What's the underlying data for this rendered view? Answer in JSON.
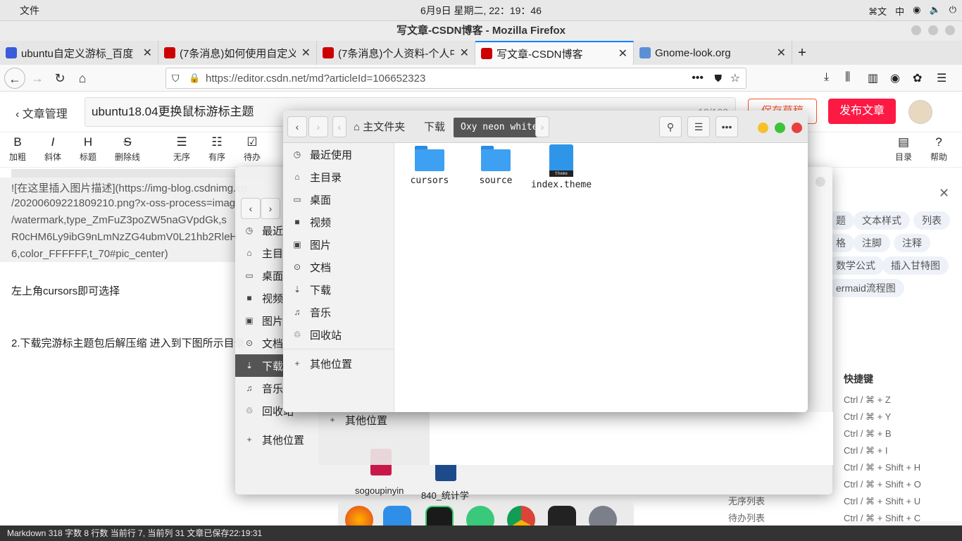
{
  "menubar": {
    "app_menu": "文件",
    "clock": "6月9日 星期二, 22：19：46",
    "tray": [
      "⌘文",
      "中",
      "◉",
      "🔈",
      "⏻"
    ]
  },
  "window": {
    "title": "写文章-CSDN博客 - Mozilla Firefox"
  },
  "tabs": [
    {
      "title": "ubuntu自定义游标_百度",
      "color": "#3b5bdb"
    },
    {
      "title": "(7条消息)如何使用自定义",
      "color": "#c00"
    },
    {
      "title": "(7条消息)个人资料-个人中",
      "color": "#c00"
    },
    {
      "title": "写文章-CSDN博客",
      "color": "#c00"
    },
    {
      "title": "Gnome-look.org",
      "color": "#5b8fd8"
    }
  ],
  "nav": {
    "url": "https://editor.csdn.net/md?articleId=106652323",
    "url_host": "csdn.net"
  },
  "editor": {
    "back_label": "文章管理",
    "title_value": "ubuntu18.04更换鼠标游标主题",
    "title_count": "19/100",
    "save_label": "保存草稿",
    "publish_label": "发布文章"
  },
  "toolbar": [
    {
      "glyph": "B",
      "label": "加粗"
    },
    {
      "glyph": "I",
      "label": "斜体"
    },
    {
      "glyph": "H",
      "label": "标题"
    },
    {
      "glyph": "S",
      "label": "删除线"
    },
    {
      "glyph": "☰",
      "label": "无序"
    },
    {
      "glyph": "☷",
      "label": "有序"
    },
    {
      "glyph": "☑",
      "label": "待办"
    }
  ],
  "toolbar_right": [
    {
      "glyph": "▤",
      "label": "目录"
    },
    {
      "glyph": "?",
      "label": "帮助"
    }
  ],
  "content": {
    "lines": [
      "![在这里插入图片描述](https://img-blog.csdnimg.cn",
      "/20200609221809210.png?x-oss-process=imag",
      "/watermark,type_ZmFuZ3poZW5naGVpdGk,s",
      "R0cHM6Ly9ibG9nLmNzZG4ubmV0L21hb2RleH",
      "6,color_FFFFFF,t_70#pic_center)",
      "左上角cursors即可选择",
      "2.下载完游标主题包后解压缩  进入到下图所示目录"
    ]
  },
  "right_panel": {
    "pills": [
      "题",
      "文本样式",
      "列表",
      "格",
      "注脚",
      "注释",
      "数学公式",
      "插入甘特图",
      "ermaid流程图"
    ],
    "shortcut_header": "快捷键",
    "shortcuts": [
      "Ctrl / ⌘ + Z",
      "Ctrl / ⌘ + Y",
      "Ctrl / ⌘ + B",
      "Ctrl / ⌘ + I",
      "Ctrl / ⌘ + Shift + H",
      "Ctrl / ⌘ + Shift + O",
      "Ctrl / ⌘ + Shift + U",
      "Ctrl / ⌘ + Shift + C"
    ],
    "list_labels": [
      "无序列表",
      "待办列表"
    ]
  },
  "statusbar": {
    "text": "Markdown  318 字数  8 行数  当前行 7, 当前列 31  文章已保存22:19:31"
  },
  "fm_sidebar": [
    {
      "icon": "◷",
      "label": "最近使用"
    },
    {
      "icon": "⌂",
      "label": "主目录"
    },
    {
      "icon": "▭",
      "label": "桌面"
    },
    {
      "icon": "■",
      "label": "视频"
    },
    {
      "icon": "▣",
      "label": "图片"
    },
    {
      "icon": "⊙",
      "label": "文档"
    },
    {
      "icon": "⇣",
      "label": "下载"
    },
    {
      "icon": "♫",
      "label": "音乐"
    },
    {
      "icon": "♲",
      "label": "回收站"
    }
  ],
  "fm_other": "其他位置",
  "fm_front": {
    "breadcrumb": [
      "主文件夹",
      "下载",
      "Oxy neon white"
    ],
    "files": [
      {
        "name": "cursors",
        "kind": "folder"
      },
      {
        "name": "source",
        "kind": "folder"
      },
      {
        "name": "index.theme",
        "kind": "theme",
        "badge": "theme"
      }
    ]
  },
  "fm_back": {
    "partial_files": [
      "sogoupinyin",
      "840_统计学"
    ]
  }
}
